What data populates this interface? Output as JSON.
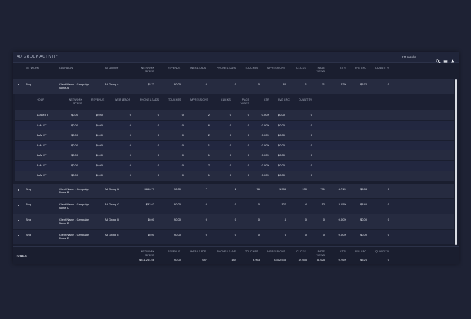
{
  "widget": {
    "title": "AD GROUP ACTIVITY",
    "results": "211 results",
    "icons": [
      "search-icon",
      "columns-icon",
      "download-icon"
    ]
  },
  "main_headers": {
    "network": "NETWORK",
    "campaign": "CAMPAIGN",
    "ad_group": "AD GROUP",
    "network_spend": "NETWORK SPEND",
    "revenue": "REVENUE",
    "web_leads": "WEB LEADS",
    "phone_leads": "PHONE LEADS",
    "touches": "TOUCHES",
    "impressions": "IMPRESSIONS",
    "clicks": "CLICKS",
    "page_views": "PAGE VIEWS",
    "ctr": "CTR",
    "avg_cpc": "AVG CPC",
    "quantity": "QUANTITY"
  },
  "rows": [
    {
      "toggle": "▾",
      "network": "Bing",
      "campaign": "Client Name - Campaign Name A",
      "ad_group": "Ad Group A",
      "network_spend": "$5.72",
      "revenue": "$0.00",
      "web_leads": "0",
      "phone_leads": "0",
      "touches": "0",
      "impressions": "82",
      "clicks": "1",
      "page_views": "11",
      "ctr": "1.22%",
      "avg_cpc": "$5.72",
      "quantity": "0"
    },
    {
      "toggle": "▸",
      "network": "Bing",
      "campaign": "Client Name - Campaign Name B",
      "ad_group": "Ad Group B",
      "network_spend": "$666.79",
      "revenue": "$0.00",
      "web_leads": "7",
      "phone_leads": "2",
      "touches": "76",
      "impressions": "1,983",
      "clicks": "130",
      "page_views": "791",
      "ctr": "4.71%",
      "avg_cpc": "$5.83",
      "quantity": "0"
    },
    {
      "toggle": "▸",
      "network": "Bing",
      "campaign": "Client Name - Campaign Name C",
      "ad_group": "Ad Group C",
      "network_spend": "$33.62",
      "revenue": "$0.00",
      "web_leads": "0",
      "phone_leads": "0",
      "touches": "0",
      "impressions": "127",
      "clicks": "4",
      "page_views": "12",
      "ctr": "3.15%",
      "avg_cpc": "$8.40",
      "quantity": "0"
    },
    {
      "toggle": "▸",
      "network": "Bing",
      "campaign": "Client Name - Campaign Name D",
      "ad_group": "Ad Group D",
      "network_spend": "$0.00",
      "revenue": "$0.00",
      "web_leads": "0",
      "phone_leads": "0",
      "touches": "0",
      "impressions": "4",
      "clicks": "0",
      "page_views": "0",
      "ctr": "0.00%",
      "avg_cpc": "$0.00",
      "quantity": "0"
    },
    {
      "toggle": "▸",
      "network": "Bing",
      "campaign": "Client Name - Campaign Name E",
      "ad_group": "Ad Group E",
      "network_spend": "$0.00",
      "revenue": "$0.00",
      "web_leads": "0",
      "phone_leads": "0",
      "touches": "0",
      "impressions": "6",
      "clicks": "0",
      "page_views": "0",
      "ctr": "0.00%",
      "avg_cpc": "$0.00",
      "quantity": "0"
    }
  ],
  "sub_headers": {
    "hour": "HOUR",
    "network_spend": "NETWORK SPEND",
    "revenue": "REVENUE",
    "web_leads": "WEB LEADS",
    "phone_leads": "PHONE LEADS",
    "touches": "TOUCHES",
    "impressions": "IMPRESSIONS",
    "clicks": "CLICKS",
    "page_views": "PAGE VIEWS",
    "ctr": "CTR",
    "avg_cpc": "AVG CPC",
    "quantity": "QUANTITY"
  },
  "sub_rows": [
    {
      "hour": "12AM ET",
      "network_spend": "$0.00",
      "revenue": "$0.00",
      "web_leads": "0",
      "phone_leads": "0",
      "touches": "0",
      "impressions": "2",
      "clicks": "0",
      "page_views": "0",
      "ctr": "0.00%",
      "avg_cpc": "$0.00",
      "quantity": "0"
    },
    {
      "hour": "1AM ET",
      "network_spend": "$0.00",
      "revenue": "$0.00",
      "web_leads": "0",
      "phone_leads": "0",
      "touches": "0",
      "impressions": "6",
      "clicks": "0",
      "page_views": "0",
      "ctr": "0.00%",
      "avg_cpc": "$0.00",
      "quantity": "0"
    },
    {
      "hour": "3AM ET",
      "network_spend": "$0.00",
      "revenue": "$0.00",
      "web_leads": "0",
      "phone_leads": "0",
      "touches": "0",
      "impressions": "2",
      "clicks": "0",
      "page_views": "0",
      "ctr": "0.00%",
      "avg_cpc": "$0.00",
      "quantity": "0"
    },
    {
      "hour": "5AM ET",
      "network_spend": "$0.00",
      "revenue": "$0.00",
      "web_leads": "0",
      "phone_leads": "0",
      "touches": "0",
      "impressions": "1",
      "clicks": "0",
      "page_views": "0",
      "ctr": "0.00%",
      "avg_cpc": "$0.00",
      "quantity": "0"
    },
    {
      "hour": "6AM ET",
      "network_spend": "$0.00",
      "revenue": "$0.00",
      "web_leads": "0",
      "phone_leads": "0",
      "touches": "0",
      "impressions": "1",
      "clicks": "0",
      "page_views": "0",
      "ctr": "0.00%",
      "avg_cpc": "$0.00",
      "quantity": "0"
    },
    {
      "hour": "8AM ET",
      "network_spend": "$0.00",
      "revenue": "$0.00",
      "web_leads": "0",
      "phone_leads": "0",
      "touches": "0",
      "impressions": "7",
      "clicks": "0",
      "page_views": "0",
      "ctr": "0.00%",
      "avg_cpc": "$0.00",
      "quantity": "0"
    },
    {
      "hour": "9AM ET",
      "network_spend": "$0.00",
      "revenue": "$0.00",
      "web_leads": "0",
      "phone_leads": "0",
      "touches": "0",
      "impressions": "1",
      "clicks": "0",
      "page_views": "0",
      "ctr": "0.00%",
      "avg_cpc": "$0.00",
      "quantity": "0"
    }
  ],
  "totals": {
    "label": "TOTALS",
    "network_spend_label": "NETWORK SPEND",
    "network_spend": "$311,264.66",
    "revenue_label": "REVENUE",
    "revenue": "$0.00",
    "web_leads_label": "WEB LEADS",
    "web_leads": "687",
    "phone_leads_label": "PHONE LEADS",
    "phone_leads": "184",
    "touches_label": "TOUCHES",
    "touches": "6,953",
    "impressions_label": "IMPRESSIONS",
    "impressions": "3,362,533",
    "clicks_label": "CLICKS",
    "clicks": "49,655",
    "page_views_label": "PAGE VIEWS",
    "page_views": "58,625",
    "ctr_label": "CTR",
    "ctr": "0.76%",
    "avg_cpc_label": "AVG CPC",
    "avg_cpc": "$5.26",
    "quantity_label": "QUANTITY",
    "quantity": "0"
  }
}
